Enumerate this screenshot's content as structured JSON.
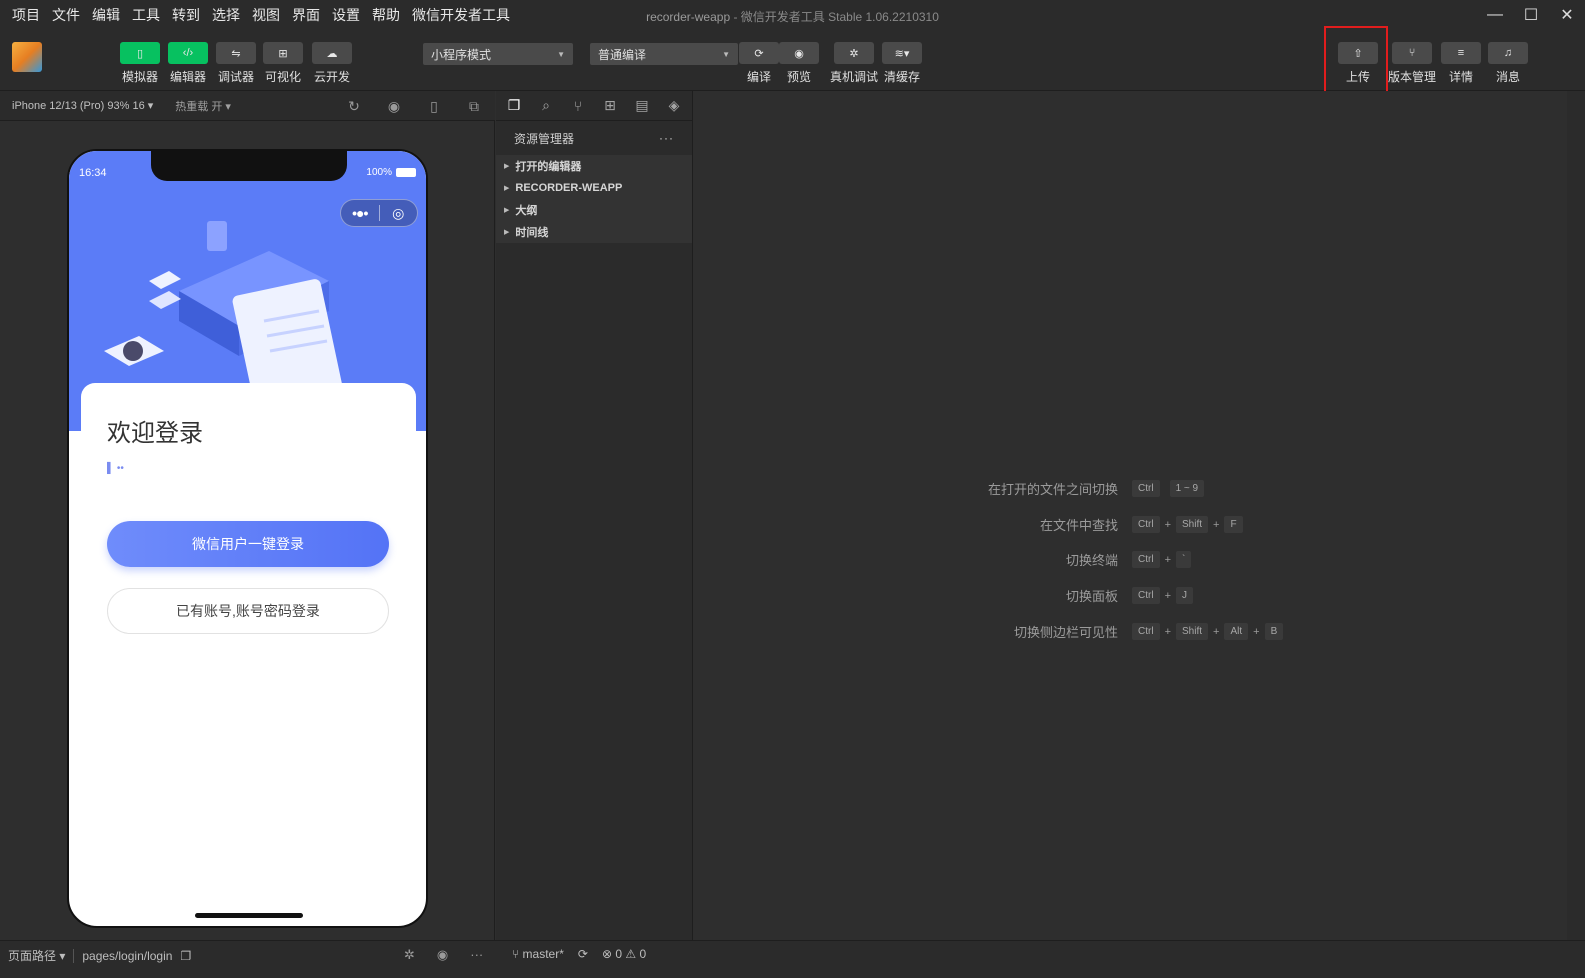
{
  "window": {
    "project": "recorder-weapp",
    "separator": " - ",
    "app_title": "微信开发者工具 Stable 1.06.2210310",
    "menu": [
      "项目",
      "文件",
      "编辑",
      "工具",
      "转到",
      "选择",
      "视图",
      "界面",
      "设置",
      "帮助",
      "微信开发者工具"
    ]
  },
  "toolbar": {
    "left_tools": [
      {
        "label": "模拟器",
        "icon": "phone-icon",
        "active": true
      },
      {
        "label": "编辑器",
        "icon": "code-icon",
        "active": true
      },
      {
        "label": "调试器",
        "icon": "debug-icon",
        "active": false
      },
      {
        "label": "可视化",
        "icon": "layout-icon",
        "active": false
      },
      {
        "label": "云开发",
        "icon": "cloud-icon",
        "active": false
      }
    ],
    "mode_select": "小程序模式",
    "compile_select": "普通编译",
    "mid_tools": [
      {
        "label": "编译",
        "icon": "refresh-icon"
      },
      {
        "label": "预览",
        "icon": "eye-icon"
      },
      {
        "label": "真机调试",
        "icon": "bug-icon"
      },
      {
        "label": "清缓存",
        "icon": "layers-icon"
      }
    ],
    "right_tools": [
      {
        "label": "上传",
        "icon": "upload-icon"
      },
      {
        "label": "版本管理",
        "icon": "branch-icon"
      },
      {
        "label": "详情",
        "icon": "menu-icon"
      },
      {
        "label": "消息",
        "icon": "bell-icon"
      }
    ]
  },
  "simulator": {
    "device": "iPhone 12/13 (Pro) 93% 16 ▾",
    "hot_reload": "热重载 开 ▾",
    "status_time": "16:34",
    "battery": "100%",
    "welcome": "欢迎登录",
    "btn_wechat_login": "微信用户一键登录",
    "btn_account_login": "已有账号,账号密码登录"
  },
  "explorer": {
    "title": "资源管理器",
    "more": "···",
    "items": [
      "打开的编辑器",
      "RECORDER-WEAPP",
      "大纲",
      "时间线"
    ]
  },
  "shortcuts": [
    {
      "name": "在打开的文件之间切换",
      "keys": [
        "Ctrl",
        "1 ~ 9"
      ]
    },
    {
      "name": "在文件中查找",
      "keys": [
        "Ctrl",
        "Shift",
        "F"
      ]
    },
    {
      "name": "切换终端",
      "keys": [
        "Ctrl",
        "`"
      ]
    },
    {
      "name": "切换面板",
      "keys": [
        "Ctrl",
        "J"
      ]
    },
    {
      "name": "切换侧边栏可见性",
      "keys": [
        "Ctrl",
        "Shift",
        "Alt",
        "B"
      ]
    }
  ],
  "statusbar": {
    "page_path_label": "页面路径 ▾",
    "page_path": "pages/login/login",
    "branch": "master*",
    "errors": "⊗ 0 ⚠ 0"
  },
  "colors": {
    "accent_green": "#07c160",
    "highlight_red": "#e11d1d",
    "brand_blue": "#5b7cf7"
  }
}
